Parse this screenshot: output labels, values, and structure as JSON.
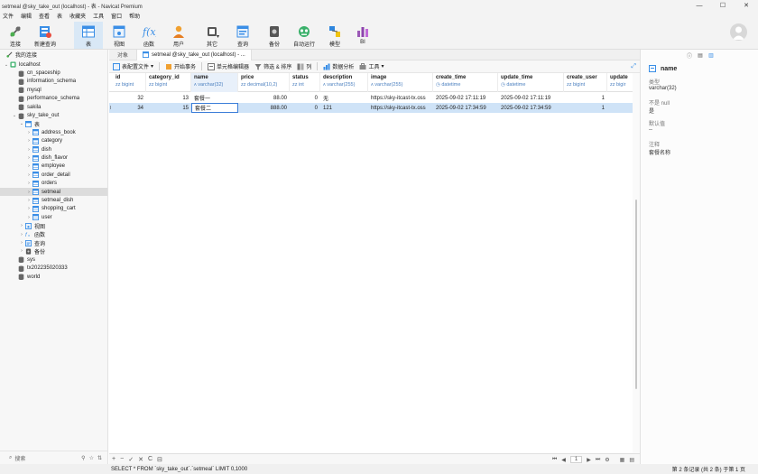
{
  "window": {
    "title": "setmeal @sky_take_out (localhost) - 表 - Navicat Premium",
    "controls": [
      "—",
      "☐",
      "✕"
    ]
  },
  "menu": [
    "文件",
    "编辑",
    "查看",
    "表",
    "收藏夹",
    "工具",
    "窗口",
    "帮助"
  ],
  "toolbar": {
    "items": [
      {
        "label": "连接",
        "icon": "connection-icon"
      },
      {
        "label": "新建查询",
        "icon": "new-query-icon"
      },
      {
        "label": "表",
        "icon": "table-icon"
      },
      {
        "label": "视图",
        "icon": "view-icon"
      },
      {
        "label": "函数",
        "icon": "function-icon"
      },
      {
        "label": "用户",
        "icon": "user-icon"
      },
      {
        "label": "其它",
        "icon": "other-icon"
      },
      {
        "label": "查询",
        "icon": "query-icon"
      },
      {
        "label": "备份",
        "icon": "backup-icon"
      },
      {
        "label": "自动运行",
        "icon": "automation-icon"
      },
      {
        "label": "模型",
        "icon": "model-icon"
      },
      {
        "label": "BI",
        "icon": "bi-icon"
      }
    ]
  },
  "sidebar": {
    "header": "我的连接",
    "search_placeholder": "搜索",
    "tree": [
      {
        "label": "localhost",
        "level": 0,
        "icon": "connection-icon",
        "expanded": true
      },
      {
        "label": "cn_spaceship",
        "level": 1,
        "icon": "database-icon"
      },
      {
        "label": "information_schema",
        "level": 1,
        "icon": "database-icon"
      },
      {
        "label": "mysql",
        "level": 1,
        "icon": "database-icon"
      },
      {
        "label": "performance_schema",
        "level": 1,
        "icon": "database-icon"
      },
      {
        "label": "sakila",
        "level": 1,
        "icon": "database-icon"
      },
      {
        "label": "sky_take_out",
        "level": 1,
        "icon": "database-icon",
        "expanded": true
      },
      {
        "label": "表",
        "level": 2,
        "icon": "tables-folder-icon",
        "expanded": true
      },
      {
        "label": "address_book",
        "level": 3,
        "icon": "table-icon"
      },
      {
        "label": "category",
        "level": 3,
        "icon": "table-icon"
      },
      {
        "label": "dish",
        "level": 3,
        "icon": "table-icon"
      },
      {
        "label": "dish_flavor",
        "level": 3,
        "icon": "table-icon"
      },
      {
        "label": "employee",
        "level": 3,
        "icon": "table-icon"
      },
      {
        "label": "order_detail",
        "level": 3,
        "icon": "table-icon"
      },
      {
        "label": "orders",
        "level": 3,
        "icon": "table-icon"
      },
      {
        "label": "setmeal",
        "level": 3,
        "icon": "table-icon",
        "selected": true
      },
      {
        "label": "setmeal_dish",
        "level": 3,
        "icon": "table-icon"
      },
      {
        "label": "shopping_cart",
        "level": 3,
        "icon": "table-icon"
      },
      {
        "label": "user",
        "level": 3,
        "icon": "table-icon"
      },
      {
        "label": "视图",
        "level": 2,
        "icon": "view-icon"
      },
      {
        "label": "函数",
        "level": 2,
        "icon": "function-icon"
      },
      {
        "label": "查询",
        "level": 2,
        "icon": "query-icon"
      },
      {
        "label": "备份",
        "level": 2,
        "icon": "backup-icon"
      },
      {
        "label": "sys",
        "level": 1,
        "icon": "database-icon"
      },
      {
        "label": "tx202235020333",
        "level": 1,
        "icon": "database-icon"
      },
      {
        "label": "world",
        "level": 1,
        "icon": "database-icon"
      }
    ]
  },
  "tabs": {
    "objects": "对象",
    "active": "setmeal @sky_take_out (localhost) - ..."
  },
  "actions": [
    "表配置文件",
    "开始事务",
    "单元格编辑器",
    "筛选 & 排序",
    "列",
    "数据分析",
    "工具"
  ],
  "grid": {
    "columns": [
      {
        "name": "id",
        "type": "bigint"
      },
      {
        "name": "category_id",
        "type": "bigint"
      },
      {
        "name": "name",
        "type": "varchar(32)"
      },
      {
        "name": "price",
        "type": "decimal(10,2)"
      },
      {
        "name": "status",
        "type": "int"
      },
      {
        "name": "description",
        "type": "varchar(255)"
      },
      {
        "name": "image",
        "type": "varchar(255)"
      },
      {
        "name": "create_time",
        "type": "datetime"
      },
      {
        "name": "update_time",
        "type": "datetime"
      },
      {
        "name": "create_user",
        "type": "bigint"
      },
      {
        "name": "update",
        "type": "bigir"
      }
    ],
    "rows": [
      {
        "id": "32",
        "category_id": "13",
        "name": "套餐一",
        "price": "88.00",
        "status": "0",
        "description": "无",
        "image": "https://sky-itcast-tx.oss",
        "create_time": "2025-09-02 17:11:19",
        "update_time": "2025-09-02 17:11:19",
        "create_user": "1",
        "update": ""
      },
      {
        "id": "34",
        "category_id": "15",
        "name": "套餐二",
        "price": "888.00",
        "status": "0",
        "description": "121",
        "image": "https://sky-itcast-tx.oss",
        "create_time": "2025-09-02 17:34:59",
        "update_time": "2025-09-02 17:34:59",
        "create_user": "1",
        "update": ""
      }
    ]
  },
  "bottom": {
    "left_controls": [
      "+",
      "−",
      "✓",
      "✕",
      "C",
      "⊟"
    ],
    "nav": [
      "⏮",
      "◀",
      "1",
      "▶",
      "⏭",
      "⚙"
    ]
  },
  "status": {
    "sql": "SELECT * FROM `sky_take_out`.`setmeal` LIMIT 0,1000",
    "count": "第 2 条记录 (共 2 条) 于第 1 页"
  },
  "inspector": {
    "field_name": "name",
    "type_label": "类型",
    "type_value": "varchar(32)",
    "notnull_label": "不是 null",
    "notnull_value": "是",
    "default_label": "默认值",
    "default_value": "--",
    "comment_label": "注释",
    "comment_value": "套餐名称"
  },
  "colors": {
    "accent": "#3b7dd8",
    "selected_row": "#cfe3f7",
    "type_text": "#4a7fbf"
  }
}
